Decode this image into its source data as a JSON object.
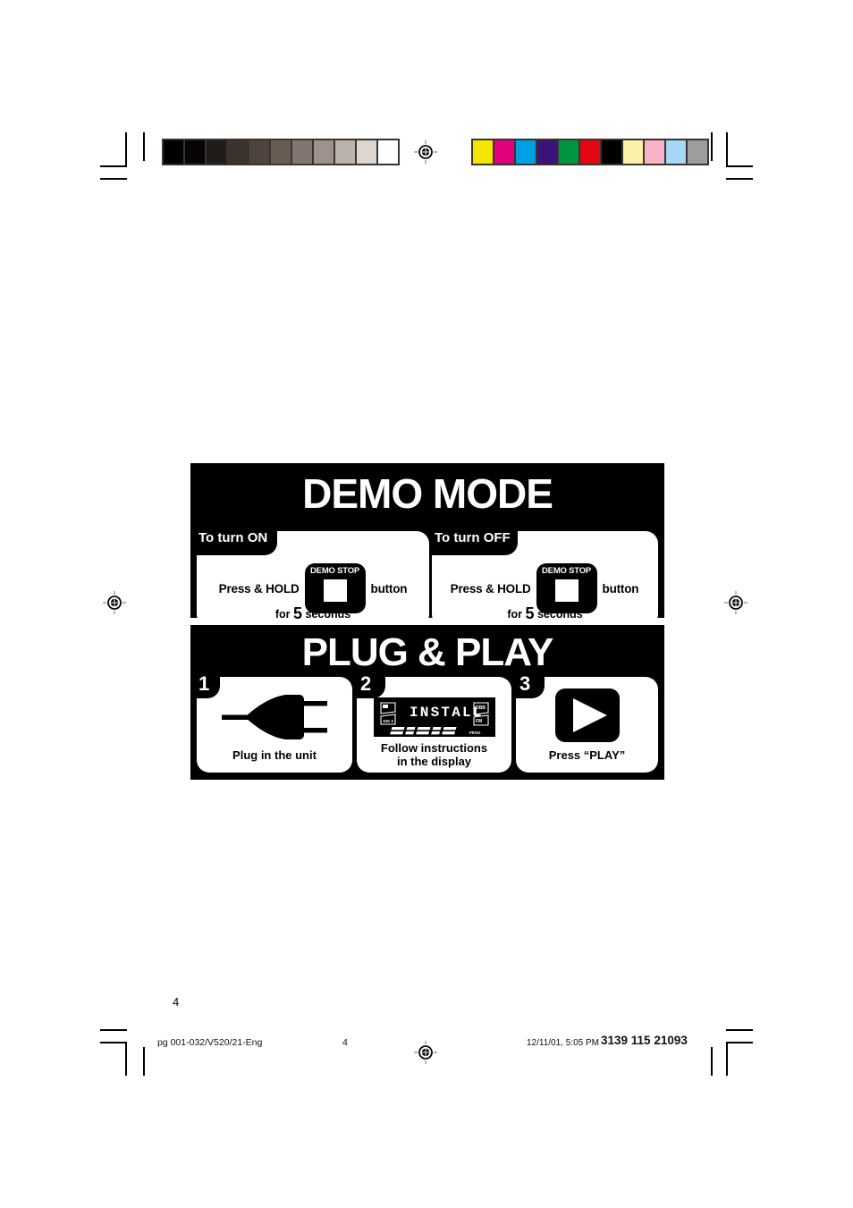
{
  "page": {
    "number": "4",
    "background": "#ffffff"
  },
  "calibration": {
    "grayscale_label": "grayscale-strip",
    "grayscale": [
      "#000000",
      "#080405",
      "#211c1a",
      "#3b322d",
      "#4e443d",
      "#675d55",
      "#827770",
      "#9e938c",
      "#bbb2ab",
      "#dbd6d0",
      "#ffffff"
    ],
    "color_label": "color-strip",
    "colors": [
      "#f5e500",
      "#e2007d",
      "#00a0e4",
      "#3b1378",
      "#009640",
      "#e30613",
      "#000000",
      "#fcf1a8",
      "#f9b2c6",
      "#a6d8f5",
      "#9d9d9c"
    ]
  },
  "demo_mode": {
    "title": "DEMO MODE",
    "panels": [
      {
        "notch_label": "To turn ON",
        "press_prefix": "Press & HOLD",
        "button_label": "DEMO STOP",
        "press_suffix": "button",
        "duration_prefix": "for",
        "duration_value": "5",
        "duration_suffix": "seconds"
      },
      {
        "notch_label": "To turn OFF",
        "press_prefix": "Press & HOLD",
        "button_label": "DEMO STOP",
        "press_suffix": "button",
        "duration_prefix": "for",
        "duration_value": "5",
        "duration_suffix": "seconds"
      }
    ]
  },
  "plug_and_play": {
    "title": "PLUG & PLAY",
    "steps": [
      {
        "number": "1",
        "icon": "power-plug-icon",
        "caption_line1": "Plug in the unit",
        "caption_line2": ""
      },
      {
        "number": "2",
        "icon": "lcd-display-icon",
        "display_text": "INSTALL",
        "caption_line1": "Follow instructions",
        "caption_line2": "in the display"
      },
      {
        "number": "3",
        "icon": "play-triangle-icon",
        "caption_line1": "Press “PLAY”",
        "caption_line2": ""
      }
    ]
  },
  "footer": {
    "file_ref": "pg 001-032/V520/21-Eng",
    "page_marker": "4",
    "timestamp": "12/11/01, 5:05 PM",
    "doc_code": "3139 115 21093"
  }
}
